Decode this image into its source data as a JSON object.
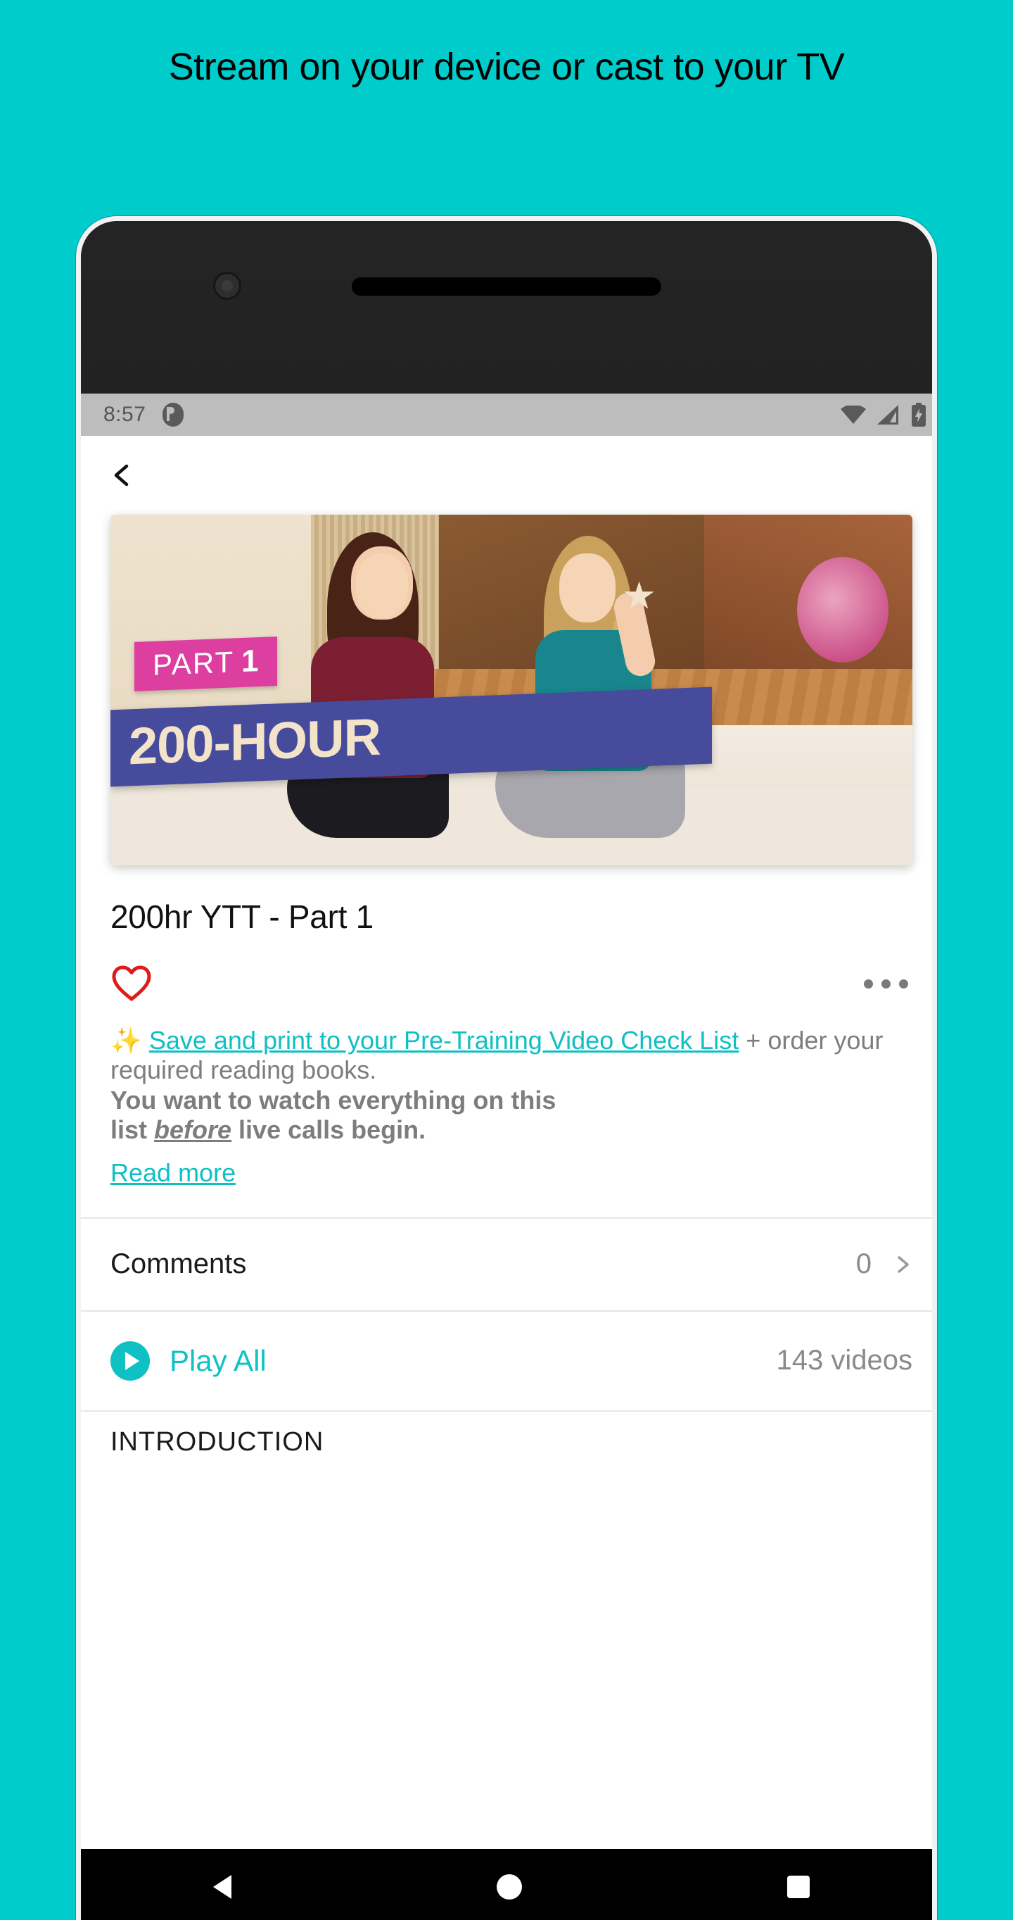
{
  "promo": {
    "headline": "Stream on your device or cast to your TV"
  },
  "colors": {
    "background": "#00CCCC",
    "accent_teal": "#10C1C4",
    "link_teal": "#0EBFC4",
    "heart_red": "#E01B1B",
    "badge_pink": "#DD3FA0",
    "badge_blue": "#474B9C",
    "statusbar_grey": "#BDBDBD"
  },
  "statusbar": {
    "time": "8:57",
    "app_icon": "app-notification-icon",
    "icons": [
      "wifi-icon",
      "cell-signal-icon",
      "battery-charging-icon"
    ]
  },
  "appbar": {
    "back_icon": "back-chevron-icon"
  },
  "hero": {
    "badge_part_label": "PART",
    "badge_part_number": "1",
    "badge_title": "200-HOUR"
  },
  "video": {
    "title": "200hr YTT - Part 1",
    "favorite_icon": "heart-outline-icon",
    "overflow_icon": "more-options-icon"
  },
  "description": {
    "sparkle": "✨",
    "link_text": "Save and print to your Pre-Training Video Check List",
    "after_link": " + order your required reading books.",
    "bold_line_1": "You want to watch everything on this",
    "bold_line_2_pre": "list ",
    "bold_line_2_em": "before",
    "bold_line_2_post": " live calls begin.",
    "read_more": "Read more"
  },
  "comments": {
    "label": "Comments",
    "count": "0",
    "chevron_icon": "chevron-right-icon"
  },
  "playlist": {
    "play_icon": "play-circle-icon",
    "play_label": "Play All",
    "video_count": "143 videos",
    "section_title": "INTRODUCTION"
  },
  "navbar": {
    "back": "nav-back-icon",
    "home": "nav-home-icon",
    "recents": "nav-recents-icon"
  }
}
